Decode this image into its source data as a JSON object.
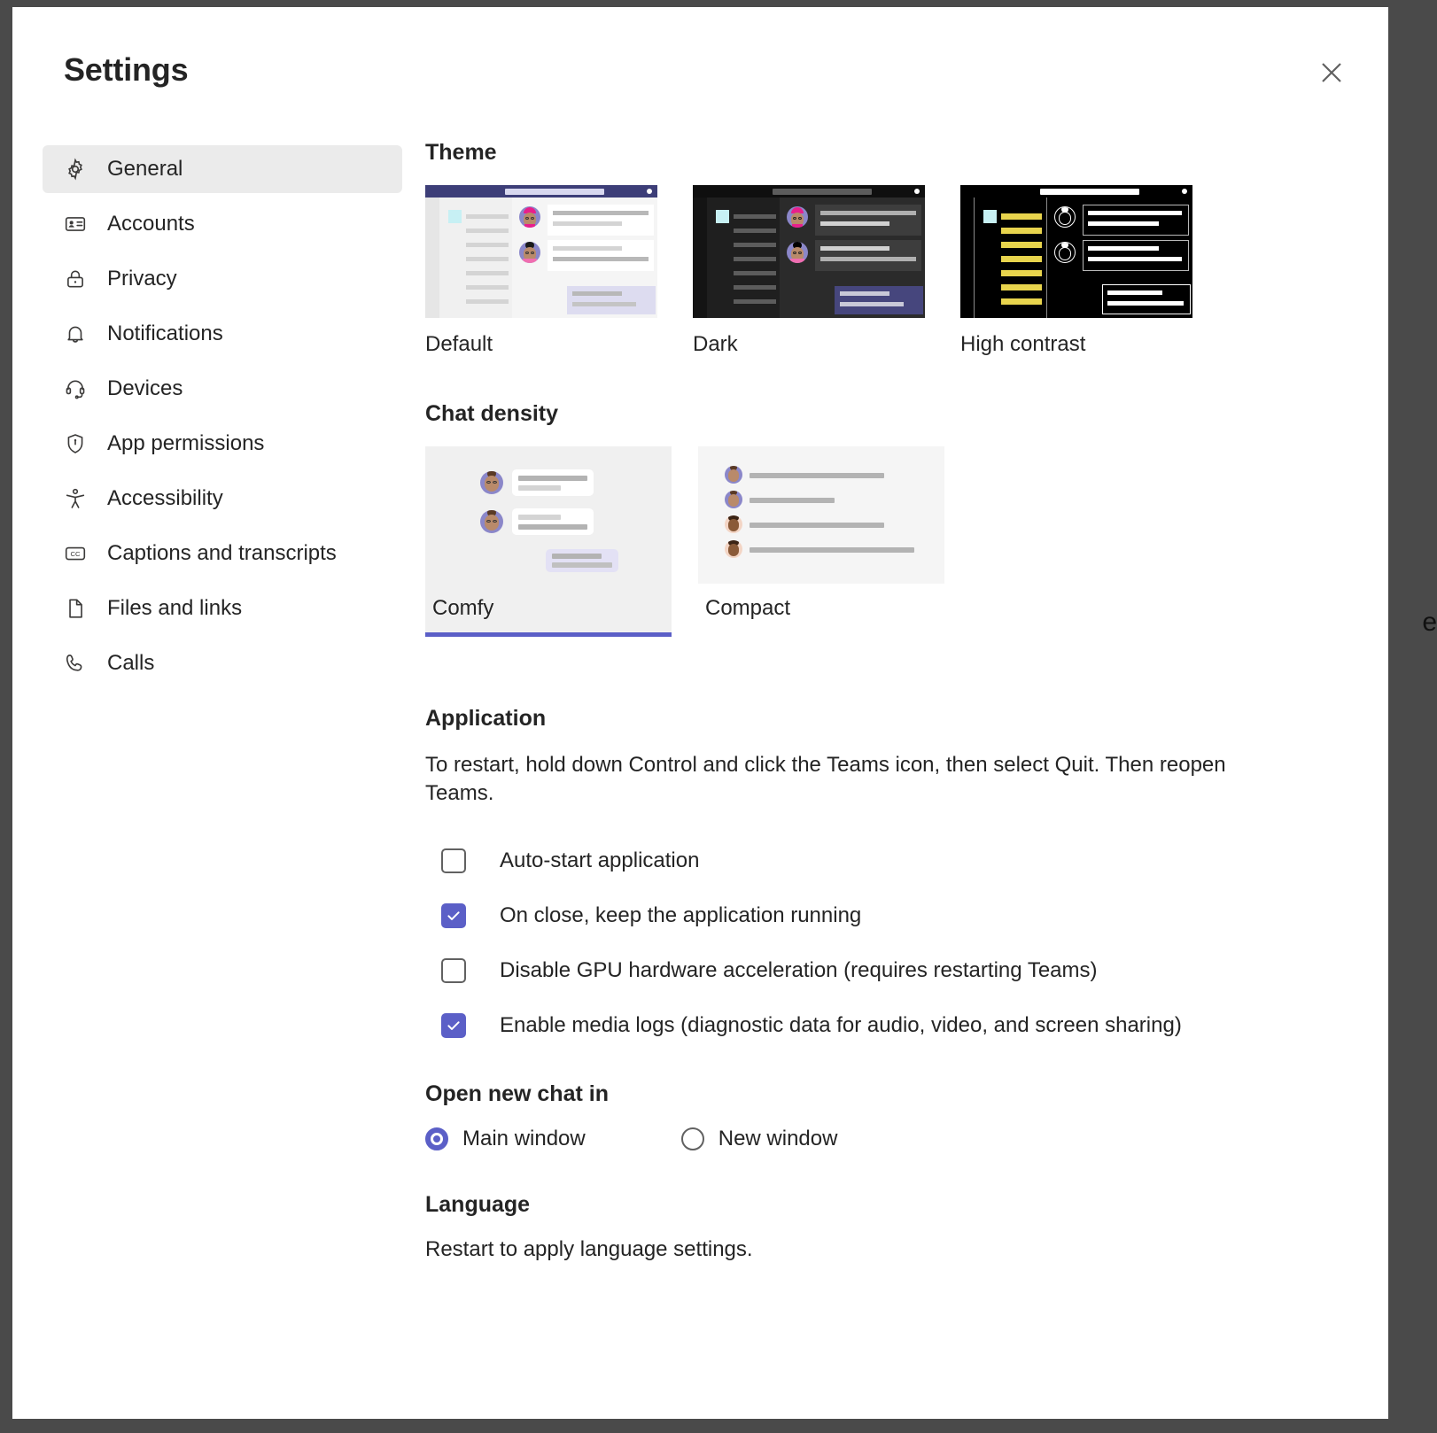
{
  "window": {
    "title": "Settings",
    "close_icon": "close-icon"
  },
  "sidebar": {
    "items": [
      {
        "label": "General",
        "icon": "gear-icon",
        "selected": true
      },
      {
        "label": "Accounts",
        "icon": "contact-card-icon",
        "selected": false
      },
      {
        "label": "Privacy",
        "icon": "lock-icon",
        "selected": false
      },
      {
        "label": "Notifications",
        "icon": "bell-icon",
        "selected": false
      },
      {
        "label": "Devices",
        "icon": "headset-icon",
        "selected": false
      },
      {
        "label": "App permissions",
        "icon": "shield-icon",
        "selected": false
      },
      {
        "label": "Accessibility",
        "icon": "accessibility-person-icon",
        "selected": false
      },
      {
        "label": "Captions and transcripts",
        "icon": "closed-caption-icon",
        "selected": false
      },
      {
        "label": "Files and links",
        "icon": "document-icon",
        "selected": false
      },
      {
        "label": "Calls",
        "icon": "phone-icon",
        "selected": false
      }
    ]
  },
  "theme": {
    "heading": "Theme",
    "options": [
      {
        "label": "Default",
        "selected": false
      },
      {
        "label": "Dark",
        "selected": false
      },
      {
        "label": "High contrast",
        "selected": false
      }
    ]
  },
  "chat_density": {
    "heading": "Chat density",
    "options": [
      {
        "label": "Comfy",
        "selected": true
      },
      {
        "label": "Compact",
        "selected": false
      }
    ]
  },
  "application": {
    "heading": "Application",
    "description": "To restart, hold down Control and click the Teams icon, then select Quit. Then reopen Teams.",
    "checkboxes": [
      {
        "label": "Auto-start application",
        "checked": false
      },
      {
        "label": "On close, keep the application running",
        "checked": true
      },
      {
        "label": "Disable GPU hardware acceleration (requires restarting Teams)",
        "checked": false
      },
      {
        "label": "Enable media logs (diagnostic data for audio, video, and screen sharing)",
        "checked": true
      }
    ]
  },
  "open_new_chat_in": {
    "heading": "Open new chat in",
    "options": [
      {
        "label": "Main window",
        "selected": true
      },
      {
        "label": "New window",
        "selected": false
      }
    ]
  },
  "language": {
    "heading": "Language",
    "description": "Restart to apply language settings."
  },
  "desktop": {
    "edge_glyph": "e"
  },
  "colors": {
    "accent": "#5b5fc7",
    "selected_nav_bg": "#ebebeb",
    "text": "#242424",
    "desktop_bg": "#4a4a4a"
  }
}
